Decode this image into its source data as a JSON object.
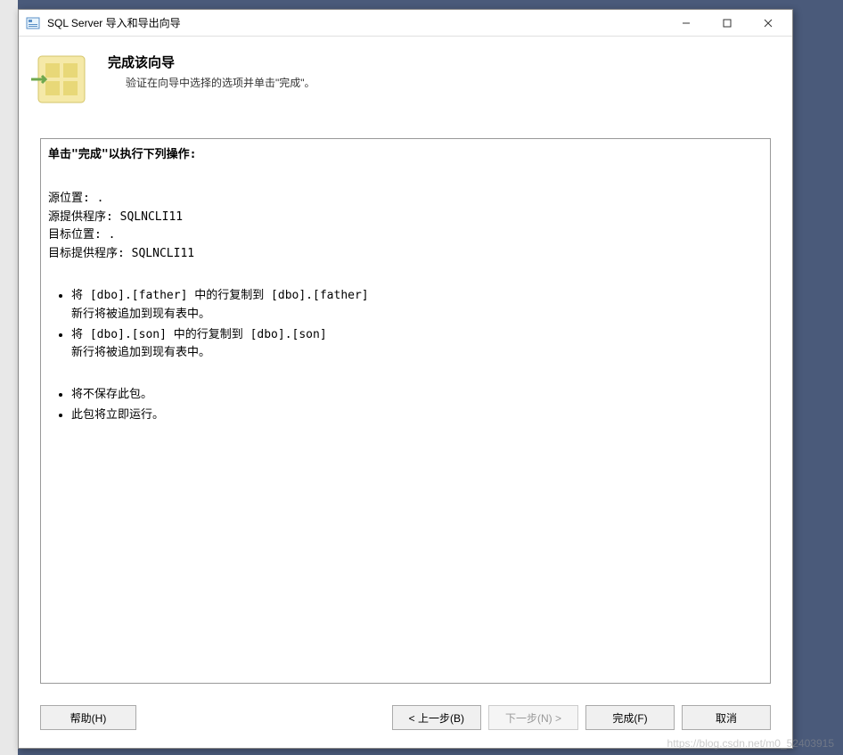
{
  "window": {
    "title": "SQL Server 导入和导出向导"
  },
  "header": {
    "title": "完成该向导",
    "subtitle": "验证在向导中选择的选项并单击\"完成\"。"
  },
  "panel": {
    "heading": "单击\"完成\"以执行下列操作:",
    "source_location_label": "源位置: .",
    "source_provider_label": "源提供程序: SQLNCLI11",
    "target_location_label": "目标位置: .",
    "target_provider_label": "目标提供程序: SQLNCLI11",
    "copy_items": [
      {
        "main": "将 [dbo].[father] 中的行复制到 [dbo].[father]",
        "sub": "新行将被追加到现有表中。"
      },
      {
        "main": "将 [dbo].[son] 中的行复制到 [dbo].[son]",
        "sub": "新行将被追加到现有表中。"
      }
    ],
    "final_items": [
      "将不保存此包。",
      "此包将立即运行。"
    ]
  },
  "buttons": {
    "help": "帮助(H)",
    "back": "< 上一步(B)",
    "next": "下一步(N) >",
    "finish": "完成(F)",
    "cancel": "取消"
  },
  "watermark": "https://blog.csdn.net/m0_52403915"
}
